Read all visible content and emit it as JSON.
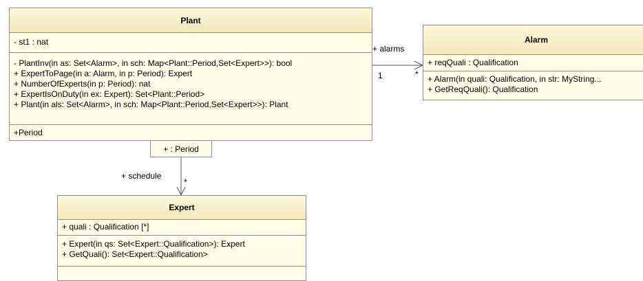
{
  "plant": {
    "name": "Plant",
    "attributes": [
      "- st1 : nat"
    ],
    "operations": [
      "- PlantInv(in as: Set<Alarm>, in sch: Map<Plant::Period,Set<Expert>>): bool",
      "+ ExpertToPage(in a: Alarm, in p: Period): Expert",
      "+ NumberOfExperts(in p: Period): nat",
      "+ ExpertIsOnDuty(in ex: Expert): Set<Plant::Period>",
      "+ Plant(in als: Set<Alarm>, in sch: Map<Plant::Period,Set<Expert>>): Plant"
    ],
    "nested": [
      "+Period"
    ],
    "qualifier": "+ : Period"
  },
  "alarm": {
    "name": "Alarm",
    "attributes": [
      "+ reqQuali : Qualification"
    ],
    "operations": [
      "+ Alarm(in quali: Qualification, in str: MyString...",
      "+ GetReqQuali(): Qualification"
    ]
  },
  "expert": {
    "name": "Expert",
    "attributes": [
      "+ quali : Qualification [*]"
    ],
    "operations": [
      "+ Expert(in qs: Set<Expert::Qualification>): Expert",
      "+ GetQuali(): Set<Expert::Qualification>"
    ]
  },
  "associations": {
    "alarms": {
      "role": "+ alarms",
      "source_mult": "1",
      "target_mult": "*"
    },
    "schedule": {
      "role": "+ schedule",
      "target_mult": "*"
    }
  },
  "colors": {
    "class_fill": "#fffde8",
    "header_fill": "#f6eec6",
    "border": "#8e8e8e",
    "line": "#555555"
  }
}
